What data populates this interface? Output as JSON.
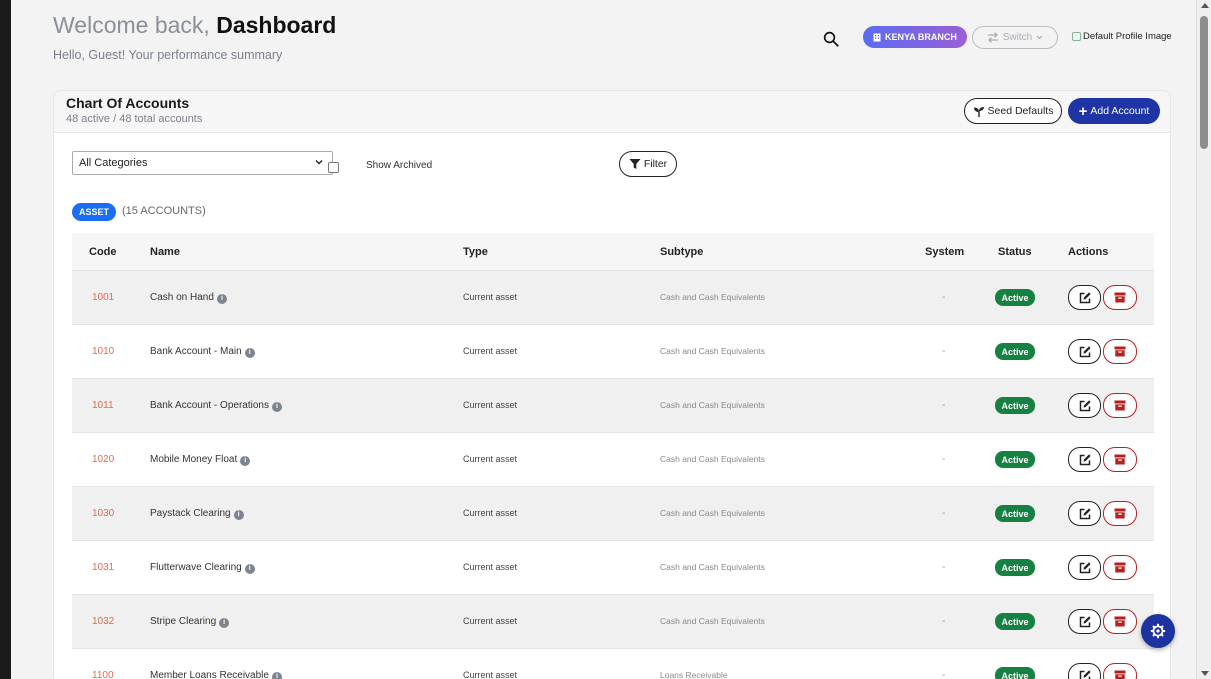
{
  "header": {
    "welcome_prefix": "Welcome back,",
    "welcome_name": "Dashboard",
    "subtitle": "Hello, Guest! Your performance summary",
    "branch_label": "KENYA BRANCH",
    "switch_label": "Switch",
    "profile_alt": "Default Profile Image"
  },
  "card": {
    "title": "Chart Of Accounts",
    "subtitle": "48 active / 48 total accounts",
    "seed_label": "Seed Defaults",
    "add_label": "Add Account"
  },
  "filters": {
    "category_value": "All Categories",
    "show_archived_label": "Show Archived",
    "filter_label": "Filter"
  },
  "group": {
    "badge": "ASSET",
    "count": "(15 ACCOUNTS)"
  },
  "table": {
    "columns": {
      "code": "Code",
      "name": "Name",
      "type": "Type",
      "subtype": "Subtype",
      "system": "System",
      "status": "Status",
      "actions": "Actions"
    },
    "rows": [
      {
        "code": "1001",
        "name": "Cash on Hand",
        "type": "Current asset",
        "subtype": "Cash and Cash Equivalents",
        "system": "-",
        "status": "Active"
      },
      {
        "code": "1010",
        "name": "Bank Account - Main",
        "type": "Current asset",
        "subtype": "Cash and Cash Equivalents",
        "system": "-",
        "status": "Active"
      },
      {
        "code": "1011",
        "name": "Bank Account - Operations",
        "type": "Current asset",
        "subtype": "Cash and Cash Equivalents",
        "system": "-",
        "status": "Active"
      },
      {
        "code": "1020",
        "name": "Mobile Money Float",
        "type": "Current asset",
        "subtype": "Cash and Cash Equivalents",
        "system": "-",
        "status": "Active"
      },
      {
        "code": "1030",
        "name": "Paystack Clearing",
        "type": "Current asset",
        "subtype": "Cash and Cash Equivalents",
        "system": "-",
        "status": "Active"
      },
      {
        "code": "1031",
        "name": "Flutterwave Clearing",
        "type": "Current asset",
        "subtype": "Cash and Cash Equivalents",
        "system": "-",
        "status": "Active"
      },
      {
        "code": "1032",
        "name": "Stripe Clearing",
        "type": "Current asset",
        "subtype": "Cash and Cash Equivalents",
        "system": "-",
        "status": "Active"
      },
      {
        "code": "1100",
        "name": "Member Loans Receivable",
        "type": "Current asset",
        "subtype": "Loans Receivable",
        "system": "-",
        "status": "Active"
      }
    ]
  },
  "colors": {
    "primary": "#1f35a6",
    "badge_blue": "#1b6ef3",
    "active_green": "#168242",
    "delete_red": "#b72020",
    "code_orange": "#e4684e"
  }
}
